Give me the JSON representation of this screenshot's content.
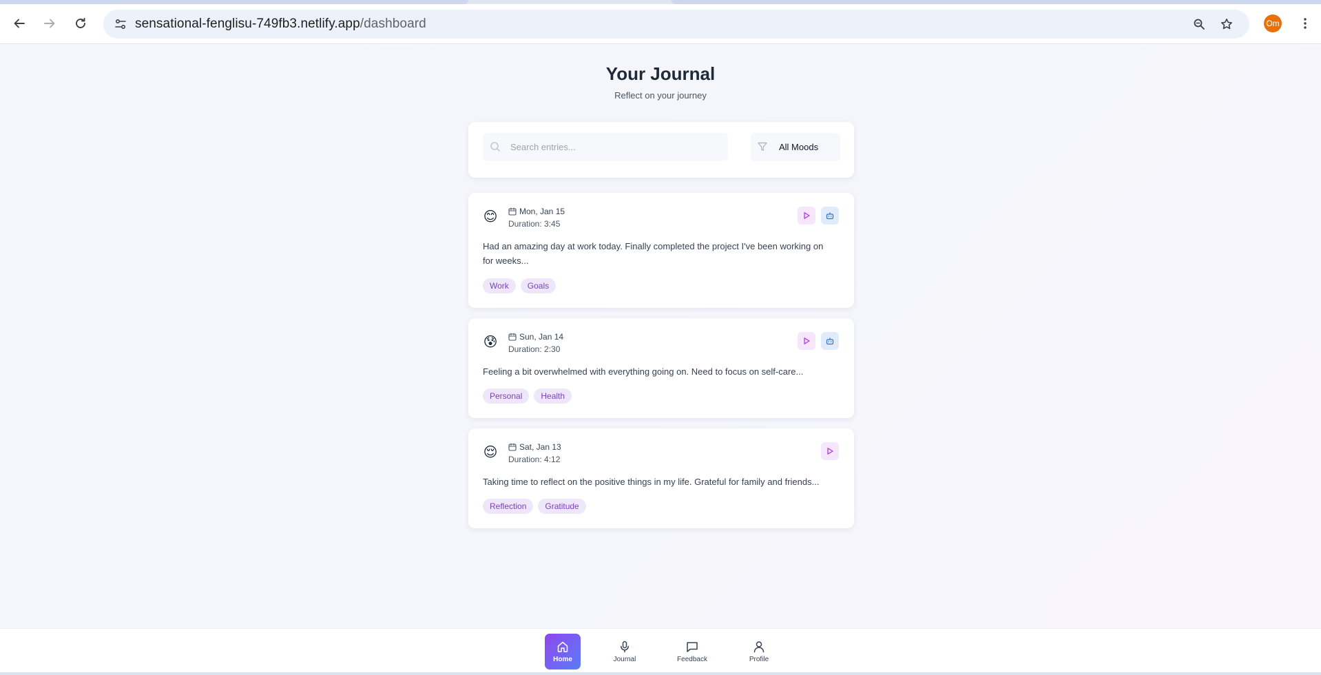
{
  "browser": {
    "url_host": "sensational-fenglisu-749fb3.netlify.app",
    "url_path": "/dashboard",
    "profile_initials": "Om",
    "profile_color": "#e8710a"
  },
  "header": {
    "title": "Your Journal",
    "subtitle": "Reflect on your journey"
  },
  "filters": {
    "search_placeholder": "Search entries...",
    "search_value": "",
    "mood_selected": "All Moods"
  },
  "entries": [
    {
      "mood_icon": "😊",
      "mood_name": "happy",
      "date": "Mon, Jan 15",
      "duration": "Duration: 3:45",
      "text": "Had an amazing day at work today. Finally completed the project I've been working on for weeks...",
      "tags": [
        "Work",
        "Goals"
      ],
      "actions": [
        "play",
        "ai"
      ]
    },
    {
      "mood_icon": "😰",
      "mood_name": "anxious",
      "date": "Sun, Jan 14",
      "duration": "Duration: 2:30",
      "text": "Feeling a bit overwhelmed with everything going on. Need to focus on self-care...",
      "tags": [
        "Personal",
        "Health"
      ],
      "actions": [
        "play",
        "ai"
      ]
    },
    {
      "mood_icon": "😌",
      "mood_name": "calm",
      "date": "Sat, Jan 13",
      "duration": "Duration: 4:12",
      "text": "Taking time to reflect on the positive things in my life. Grateful for family and friends...",
      "tags": [
        "Reflection",
        "Gratitude"
      ],
      "actions": [
        "play"
      ]
    }
  ],
  "nav": {
    "items": [
      {
        "label": "Home",
        "icon": "home-icon",
        "active": true
      },
      {
        "label": "Journal",
        "icon": "microphone-icon",
        "active": false
      },
      {
        "label": "Feedback",
        "icon": "message-icon",
        "active": false
      },
      {
        "label": "Profile",
        "icon": "user-icon",
        "active": false
      }
    ]
  },
  "colors": {
    "accent_purple": "#8f46ee",
    "accent_blue": "#5b7cf7",
    "tag_bg": "#ede7f9",
    "tag_text": "#7b3fbd"
  }
}
